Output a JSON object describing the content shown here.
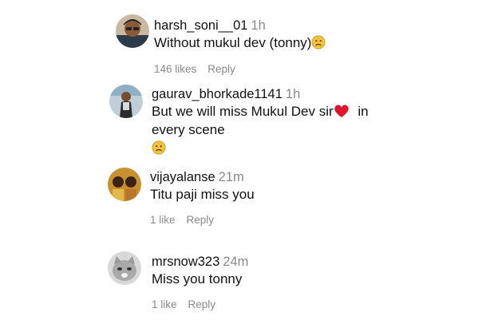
{
  "comments": [
    {
      "username": "harsh_soni__01",
      "time": "1h",
      "text": "Without mukul dev (tonny)",
      "likes": "146 likes",
      "reply": "Reply",
      "avatar_icon": "user-photo-icon"
    },
    {
      "username": "gaurav_bhorkade1141",
      "time": "1h",
      "text_line1": "But we will miss Mukul Dev sir",
      "text_line1_end": " in",
      "text_line2": "every scene",
      "avatar_icon": "user-photo-icon"
    },
    {
      "username": "vijayalanse",
      "time": "21m",
      "text": "Titu paji miss you",
      "likes": "1 like",
      "reply": "Reply",
      "avatar_icon": "user-photo-icon"
    },
    {
      "username": "mrsnow323",
      "time": "24m",
      "text": "Miss you tonny",
      "likes": "1 like",
      "reply": "Reply",
      "avatar_icon": "cat-photo-icon"
    }
  ],
  "emojis": {
    "sad": "sad-face-emoji",
    "heart": "red-heart-emoji"
  },
  "colors": {
    "meta_gray": "#8a8a8a",
    "emoji_yellow": "#f6c23a",
    "heart_red": "#e0152b"
  }
}
